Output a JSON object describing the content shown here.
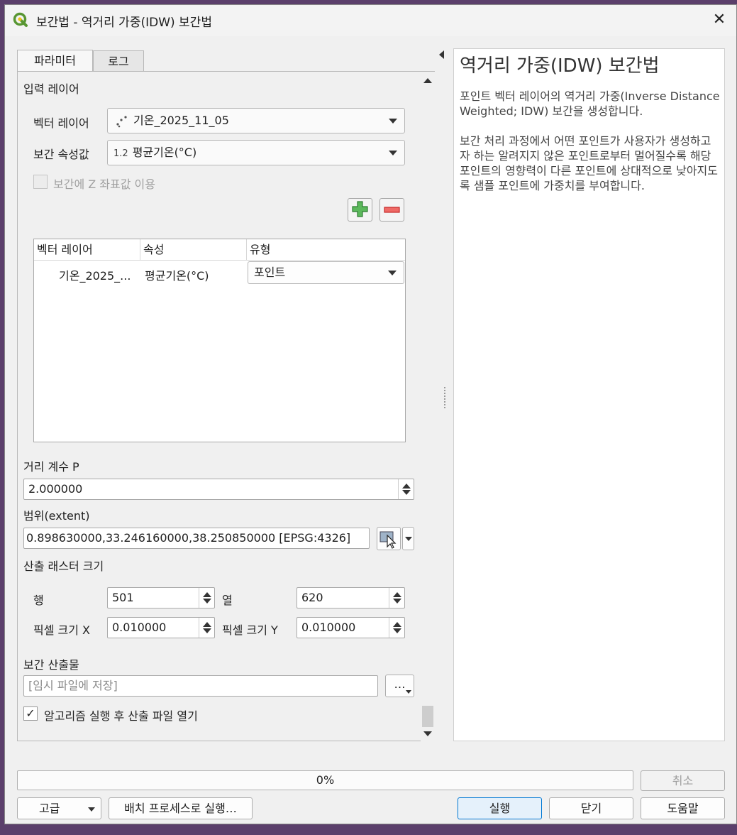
{
  "window": {
    "title": "보간법 - 역거리 가중(IDW) 보간법",
    "close_glyph": "✕"
  },
  "tabs": [
    {
      "label": "파라미터",
      "active": true
    },
    {
      "label": "로그",
      "active": false
    }
  ],
  "params": {
    "input_layer_section": "입력 레이어",
    "vector_layer_label": "벡터 레이어",
    "vector_layer_value": "기온_2025_11_05",
    "interp_attr_label": "보간 속성값",
    "interp_attr_type": "1.2",
    "interp_attr_value": "평균기온(°C)",
    "use_z_label": "보간에 Z 좌표값 이용",
    "table": {
      "headers": [
        "벡터 레이어",
        "속성",
        "유형"
      ],
      "rows": [
        {
          "layer": "기온_2025_...",
          "attribute": "평균기온(°C)",
          "type": "포인트"
        }
      ]
    },
    "distance_p_label": "거리 계수 P",
    "distance_p_value": "2.000000",
    "extent_label": "범위(extent)",
    "extent_value": "0.898630000,33.246160000,38.250850000 [EPSG:4326]",
    "raster_size_label": "산출 래스터 크기",
    "rows_label": "행",
    "rows_value": "501",
    "cols_label": "열",
    "cols_value": "620",
    "pixel_x_label": "픽셀 크기 X",
    "pixel_x_value": "0.010000",
    "pixel_y_label": "픽셀 크기 Y",
    "pixel_y_value": "0.010000",
    "output_label": "보간 산출물",
    "output_placeholder": "[임시 파일에 저장]",
    "browse_glyph": "…",
    "open_after_label": "알고리즘 실행 후 산출 파일 열기",
    "open_after_checked": true
  },
  "help": {
    "title": "역거리 가중(IDW) 보간법",
    "paragraph1": "포인트 벡터 레이어의 역거리 가중(Inverse Distance Weighted; IDW) 보간을 생성합니다.",
    "paragraph2": "보간 처리 과정에서 어떤 포인트가 사용자가 생성하고자 하는 알려지지 않은 포인트로부터 멀어질수록 해당 포인트의 영향력이 다른 포인트에 상대적으로 낮아지도록 샘플 포인트에 가중치를 부여합니다."
  },
  "progress": {
    "text": "0%",
    "value": 0
  },
  "buttons": {
    "cancel": "취소",
    "advanced": "고급",
    "batch": "배치 프로세스로 실행…",
    "run": "실행",
    "close": "닫기",
    "help": "도움말"
  },
  "colors": {
    "accent": "#0078d4",
    "qgis_green": "#589632",
    "qgis_yellow": "#f0c419",
    "add_green": "#3c9a2e",
    "remove_red": "#d9413c"
  }
}
